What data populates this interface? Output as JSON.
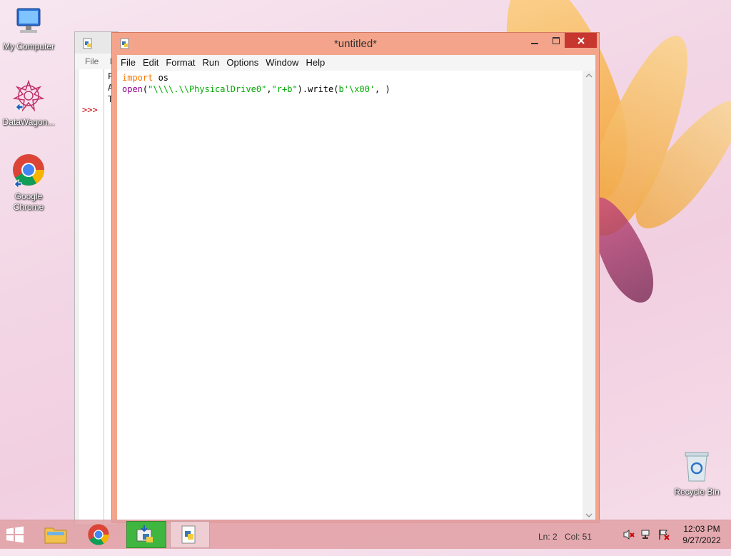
{
  "desktop": {
    "icons": [
      {
        "label": "My Computer"
      },
      {
        "label": "DataWagon..."
      },
      {
        "label": "Google Chrome"
      },
      {
        "label": "Recycle Bin"
      }
    ]
  },
  "shell": {
    "menu_first": "File",
    "menu_second": "E",
    "lines": [
      "P",
      "A",
      "T"
    ],
    "prompt": ">>>"
  },
  "editor": {
    "title": "*untitled*",
    "menu": [
      "File",
      "Edit",
      "Format",
      "Run",
      "Options",
      "Window",
      "Help"
    ],
    "code": {
      "line1_kw": "import",
      "line1_rest": " os",
      "line2_fn": "open",
      "line2_p1": "(",
      "line2_s1": "\"\\\\\\\\.\\\\PhysicalDrive0\"",
      "line2_comma": ",",
      "line2_s2": "\"r+b\"",
      "line2_mid": ").write(",
      "line2_s3": "b'\\x00'",
      "line2_end": ", )"
    },
    "status_ln": "Ln: 2",
    "status_col": "Col: 51"
  },
  "taskbar": {
    "time": "12:03 PM",
    "date": "9/27/2022"
  },
  "colors": {
    "editor_frame": "#f4a48a",
    "close_button": "#c7372f",
    "keyword": "#ff7700",
    "builtin": "#900090",
    "string": "#00aa00"
  }
}
